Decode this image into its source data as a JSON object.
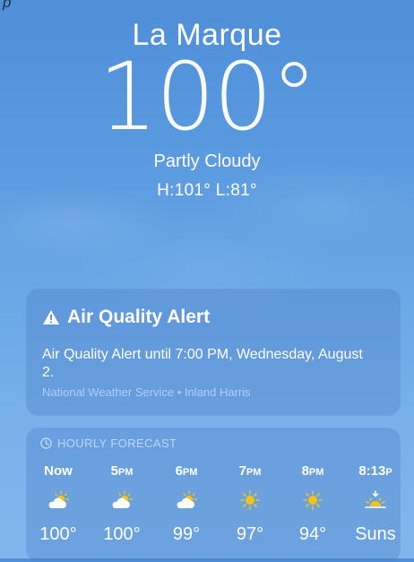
{
  "top_partial_text": "p",
  "location": {
    "city": "La Marque",
    "temperature": "100°",
    "condition": "Partly Cloudy",
    "hilo": "H:101°  L:81°"
  },
  "alert": {
    "title": "Air Quality Alert",
    "body": "Air Quality Alert until 7:00 PM, Wednesday, August 2.",
    "source": "National Weather Service • Inland Harris",
    "icon": "warning-triangle-icon"
  },
  "hourly": {
    "header": "HOURLY FORECAST",
    "header_icon": "clock-icon",
    "items": [
      {
        "time": "Now",
        "suffix": "",
        "icon": "partly-cloudy-icon",
        "value": "100°"
      },
      {
        "time": "5",
        "suffix": "PM",
        "icon": "partly-cloudy-icon",
        "value": "100°"
      },
      {
        "time": "6",
        "suffix": "PM",
        "icon": "partly-cloudy-icon",
        "value": "99°"
      },
      {
        "time": "7",
        "suffix": "PM",
        "icon": "sun-icon",
        "value": "97°"
      },
      {
        "time": "8",
        "suffix": "PM",
        "icon": "sun-icon",
        "value": "94°"
      },
      {
        "time": "8:13",
        "suffix": "P",
        "icon": "sunset-icon",
        "value": "Suns"
      }
    ]
  },
  "colors": {
    "sky_top": "#4f8fd8",
    "sky_bottom": "#7fb7ec",
    "sun": "#f5c21a"
  }
}
